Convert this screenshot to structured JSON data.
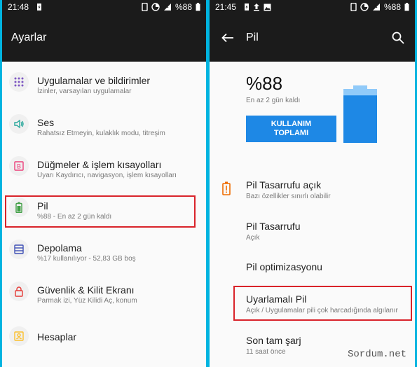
{
  "left": {
    "status": {
      "time": "21:48",
      "battery": "%88"
    },
    "title": "Ayarlar",
    "items": [
      {
        "label": "Uygulamalar ve bildirimler",
        "sub": "İzinler, varsayılan uygulamalar",
        "icon": "apps-grid-icon",
        "color": "#7e57c2"
      },
      {
        "label": "Ses",
        "sub": "Rahatsız Etmeyin, kulaklık modu, titreşim",
        "icon": "speaker-icon",
        "color": "#26a69a"
      },
      {
        "label": "Düğmeler & işlem kısayolları",
        "sub": "Uyarı Kaydırıcı, navigasyon, işlem kısayolları",
        "icon": "buttons-icon",
        "color": "#ec407a"
      },
      {
        "label": "Pil",
        "sub": "%88 - En az 2 gün kaldı",
        "icon": "battery-icon",
        "color": "#43a047"
      },
      {
        "label": "Depolama",
        "sub": "%17 kullanılıyor - 52,83 GB boş",
        "icon": "storage-icon",
        "color": "#3f51b5"
      },
      {
        "label": "Güvenlik & Kilit Ekranı",
        "sub": "Parmak izi, Yüz Kilidi Aç, konum",
        "icon": "lock-icon",
        "color": "#e53935"
      },
      {
        "label": "Hesaplar",
        "sub": "",
        "icon": "account-icon",
        "color": "#fbc02d"
      }
    ]
  },
  "right": {
    "status": {
      "time": "21:45",
      "battery": "%88"
    },
    "title": "Pil",
    "battery_percent": "%88",
    "battery_level": 0.88,
    "remaining": "En az 2 gün kaldı",
    "usage_button_line1": "KULLANIM",
    "usage_button_line2": "TOPLAMI",
    "items": [
      {
        "label": "Pil Tasarrufu açık",
        "sub": "Bazı özellikler sınırlı olabilir"
      },
      {
        "label": "Pil Tasarrufu",
        "sub": "Açık"
      },
      {
        "label": "Pil optimizasyonu",
        "sub": ""
      },
      {
        "label": "Uyarlamalı Pil",
        "sub": "Açık / Uygulamalar pili çok harcadığında algılanır"
      },
      {
        "label": "Son tam şarj",
        "sub": "11 saat önce"
      }
    ]
  },
  "watermark": "Sordum.net",
  "colors": {
    "highlight": "#d9232a",
    "accent": "#1e88e5",
    "saver": "#ef6c00",
    "appbar": "#1b1b1b",
    "background_border": "#00b4e0"
  }
}
